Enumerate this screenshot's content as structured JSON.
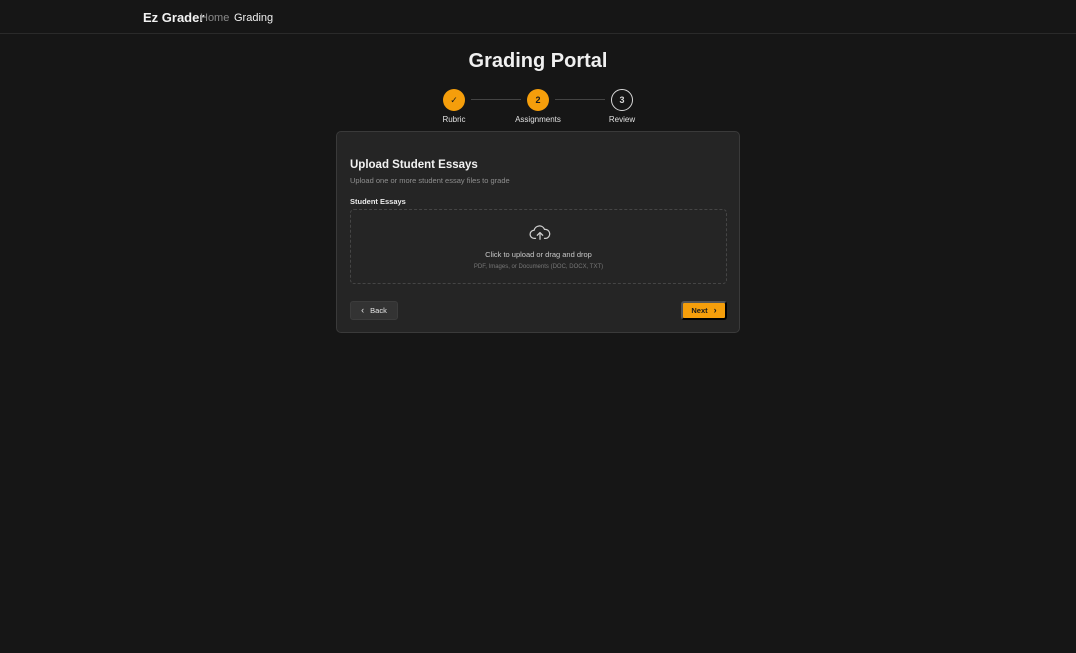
{
  "nav": {
    "brand": "Ez Grader",
    "links": [
      "Home",
      "Grading"
    ]
  },
  "page": {
    "title": "Grading Portal"
  },
  "stepper": {
    "steps": [
      {
        "label": "Rubric",
        "state": "done",
        "marker": "✓"
      },
      {
        "label": "Assignments",
        "state": "active",
        "marker": "2"
      },
      {
        "label": "Review",
        "state": "todo",
        "marker": "3"
      }
    ]
  },
  "card": {
    "title": "Upload Student Essays",
    "subtitle": "Upload one or more student essay files to grade",
    "field_label": "Student Essays",
    "dropzone": {
      "icon": "cloud-upload-icon",
      "text": "Click to upload or drag and drop",
      "hint": "PDF, Images, or Documents (DOC, DOCX, TXT)"
    },
    "back_label": "Back",
    "next_label": "Next"
  },
  "colors": {
    "background": "#161616",
    "card": "#252525",
    "accent": "#f59e0b"
  }
}
